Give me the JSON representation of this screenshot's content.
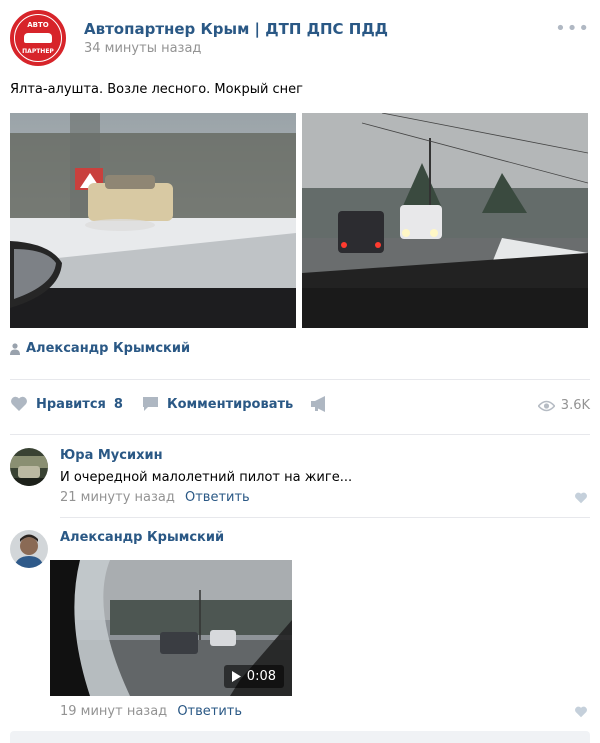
{
  "post": {
    "group_name": "Автопартнер Крым | ДТП ДПС ПДД",
    "time": "34 минуты назад",
    "logo_text_top": "АВТО",
    "logo_text_bottom": "ПАРТНЕР",
    "text": "Ялта-алушта. Возле лесного. Мокрый снег",
    "author": "Александр Крымский",
    "more_icon": "more-dots-icon"
  },
  "actions": {
    "like_label": "Нравится",
    "like_count": "8",
    "comment_label": "Комментировать",
    "views": "3.6K"
  },
  "comments": [
    {
      "name": "Юра Мусихин",
      "text": "И очередной малолетний пилот на жиге...",
      "time": "21 минуту назад",
      "reply": "Ответить"
    },
    {
      "name": "Александр Крымский",
      "video_duration": "0:08",
      "time": "19 минут назад",
      "reply": "Ответить"
    }
  ],
  "colors": {
    "link": "#2a5885",
    "muted": "#939393",
    "brand_red": "#d7242a"
  }
}
